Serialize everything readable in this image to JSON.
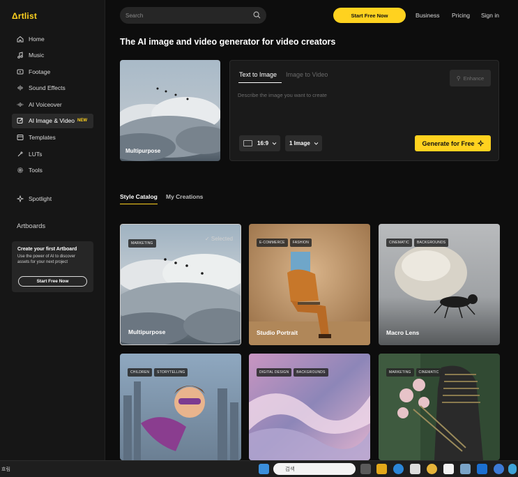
{
  "app": {
    "logo": "Δrtlist"
  },
  "colors": {
    "accent": "#ffd21f",
    "background": "#0d0d0d",
    "sidebar": "#161616"
  },
  "sidebar": {
    "items": [
      {
        "label": "Home",
        "icon": "home-icon"
      },
      {
        "label": "Music",
        "icon": "music-note-icon"
      },
      {
        "label": "Footage",
        "icon": "play-icon"
      },
      {
        "label": "Sound Effects",
        "icon": "soundwave-icon"
      },
      {
        "label": "AI Voiceover",
        "icon": "voice-bars-icon"
      },
      {
        "label": "AI Image & Video",
        "icon": "ai-edit-icon",
        "badge": "NEW",
        "active": true
      },
      {
        "label": "Templates",
        "icon": "templates-icon"
      },
      {
        "label": "LUTs",
        "icon": "dropper-icon"
      },
      {
        "label": "Tools",
        "icon": "gear-icon"
      }
    ],
    "spotlight": {
      "label": "Spotlight",
      "icon": "sparkle-icon"
    },
    "artboards_title": "Artboards",
    "artboard_card": {
      "title": "Create your first Artboard",
      "description": "Use the power of AI to discover assets for your next project",
      "button": "Start Free Now"
    }
  },
  "header": {
    "search_placeholder": "Search",
    "start_button": "Start Free Now",
    "links": [
      "Business",
      "Pricing",
      "Sign in"
    ]
  },
  "main": {
    "headline": "The AI image and video generator for video creators",
    "preview_label": "Multipurpose",
    "generator": {
      "tabs": [
        "Text to Image",
        "Image to Video"
      ],
      "active_tab": "Text to Image",
      "enhance_label": "Enhance",
      "prompt_placeholder": "Describe the image you want to create",
      "ratio": "16:9",
      "count": "1 Image",
      "generate_label": "Generate for Free"
    },
    "catalog_tabs": [
      "Style Catalog",
      "My Creations"
    ],
    "styles": [
      {
        "name": "Multipurpose",
        "tags": [
          "MARKETING"
        ],
        "selected_label": "Selected"
      },
      {
        "name": "Studio Portrait",
        "tags": [
          "E-COMMERCE",
          "FASHION"
        ]
      },
      {
        "name": "Macro Lens",
        "tags": [
          "CINEMATIC",
          "BACKGROUNDS"
        ]
      },
      {
        "name": "",
        "tags": [
          "CHILDREN",
          "STORYTELLING"
        ]
      },
      {
        "name": "",
        "tags": [
          "DIGITAL DESIGN",
          "BACKGROUNDS"
        ]
      },
      {
        "name": "",
        "tags": [
          "MARKETING",
          "CINEMATIC"
        ]
      }
    ]
  },
  "taskbar": {
    "left_text": "흐림",
    "search_placeholder": "검색"
  }
}
